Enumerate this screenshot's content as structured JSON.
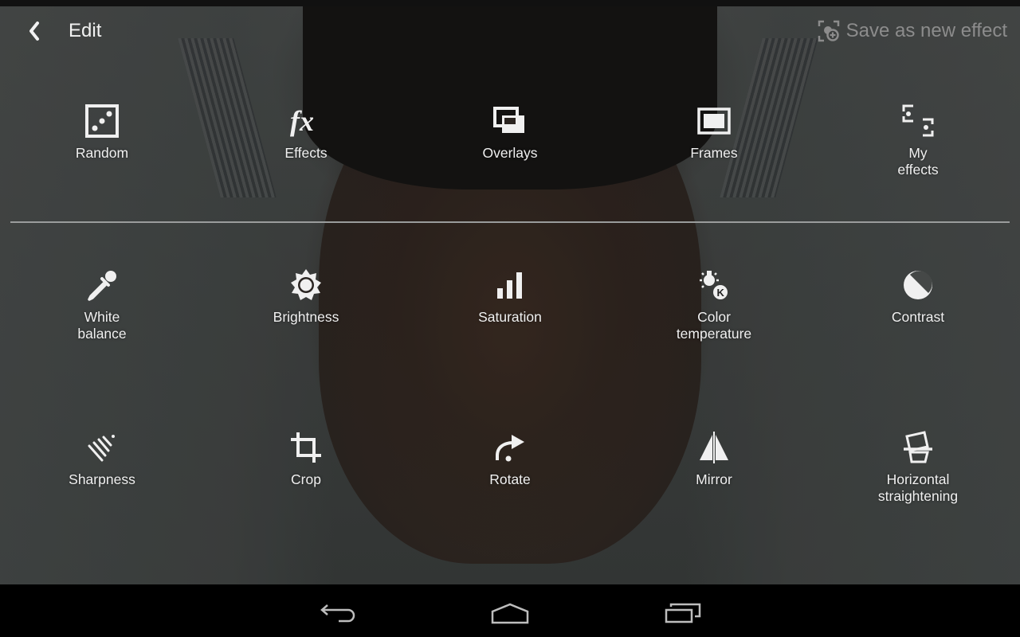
{
  "header": {
    "title": "Edit",
    "back_icon": "chevron-left-icon",
    "save_label": "Save as new effect",
    "save_icon": "save-effect-icon",
    "save_enabled": false
  },
  "effects_row": [
    {
      "label": "Random",
      "icon": "dice-icon"
    },
    {
      "label": "Effects",
      "icon": "fx-icon"
    },
    {
      "label": "Overlays",
      "icon": "overlays-icon"
    },
    {
      "label": "Frames",
      "icon": "frame-icon"
    },
    {
      "label": "My\neffects",
      "icon": "my-effects-icon"
    }
  ],
  "adjust_row": [
    {
      "label": "White\nbalance",
      "icon": "eyedropper-icon"
    },
    {
      "label": "Brightness",
      "icon": "sun-icon"
    },
    {
      "label": "Saturation",
      "icon": "bars-icon"
    },
    {
      "label": "Color\ntemperature",
      "icon": "bulb-kelvin-icon"
    },
    {
      "label": "Contrast",
      "icon": "contrast-icon"
    }
  ],
  "transform_row": [
    {
      "label": "Sharpness",
      "icon": "sharpness-icon"
    },
    {
      "label": "Crop",
      "icon": "crop-icon"
    },
    {
      "label": "Rotate",
      "icon": "rotate-icon"
    },
    {
      "label": "Mirror",
      "icon": "mirror-icon"
    },
    {
      "label": "Horizontal\nstraightening",
      "icon": "straighten-icon"
    }
  ],
  "navbar": {
    "back": "back-icon",
    "home": "home-icon",
    "recents": "recents-icon"
  },
  "colors": {
    "label": "#f0f0f0",
    "disabled": "#8c8c8c",
    "divider": "#9a9c9c"
  }
}
